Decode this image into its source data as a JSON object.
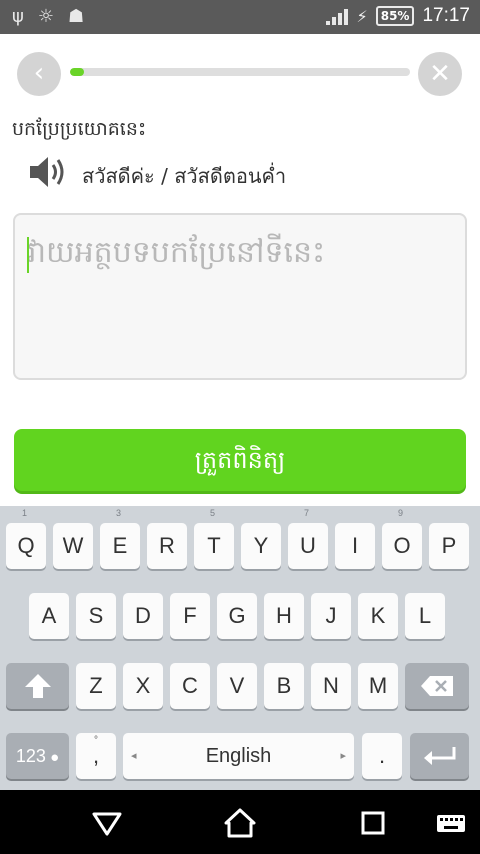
{
  "status_bar": {
    "left_icons": [
      "usb-icon",
      "bulb-icon",
      "android-icon"
    ],
    "battery": "85%",
    "time": "17:17"
  },
  "lesson": {
    "progress": 0.04,
    "prompt_label": "បកប្រែប្រយោគនេះ",
    "sentence": "สวัสดีค่ะ / สวัสดีตอนค่ำ",
    "answer_placeholder": "វាយអត្ថបទបកប្រែនៅទីនេះ",
    "answer_value": "",
    "check_label": "ត្រួតពិនិត្យ"
  },
  "keyboard": {
    "row1": [
      "Q",
      "W",
      "E",
      "R",
      "T",
      "Y",
      "U",
      "I",
      "O",
      "P"
    ],
    "row1_hints": [
      "1",
      "3",
      "5",
      "7",
      "9"
    ],
    "row2": [
      "A",
      "S",
      "D",
      "F",
      "G",
      "H",
      "J",
      "K",
      "L"
    ],
    "row3": [
      "Z",
      "X",
      "C",
      "V",
      "B",
      "N",
      "M"
    ],
    "numbers_key": "123",
    "comma_key": ",",
    "comma_sub": "°",
    "space_label": "English",
    "period_key": "."
  }
}
